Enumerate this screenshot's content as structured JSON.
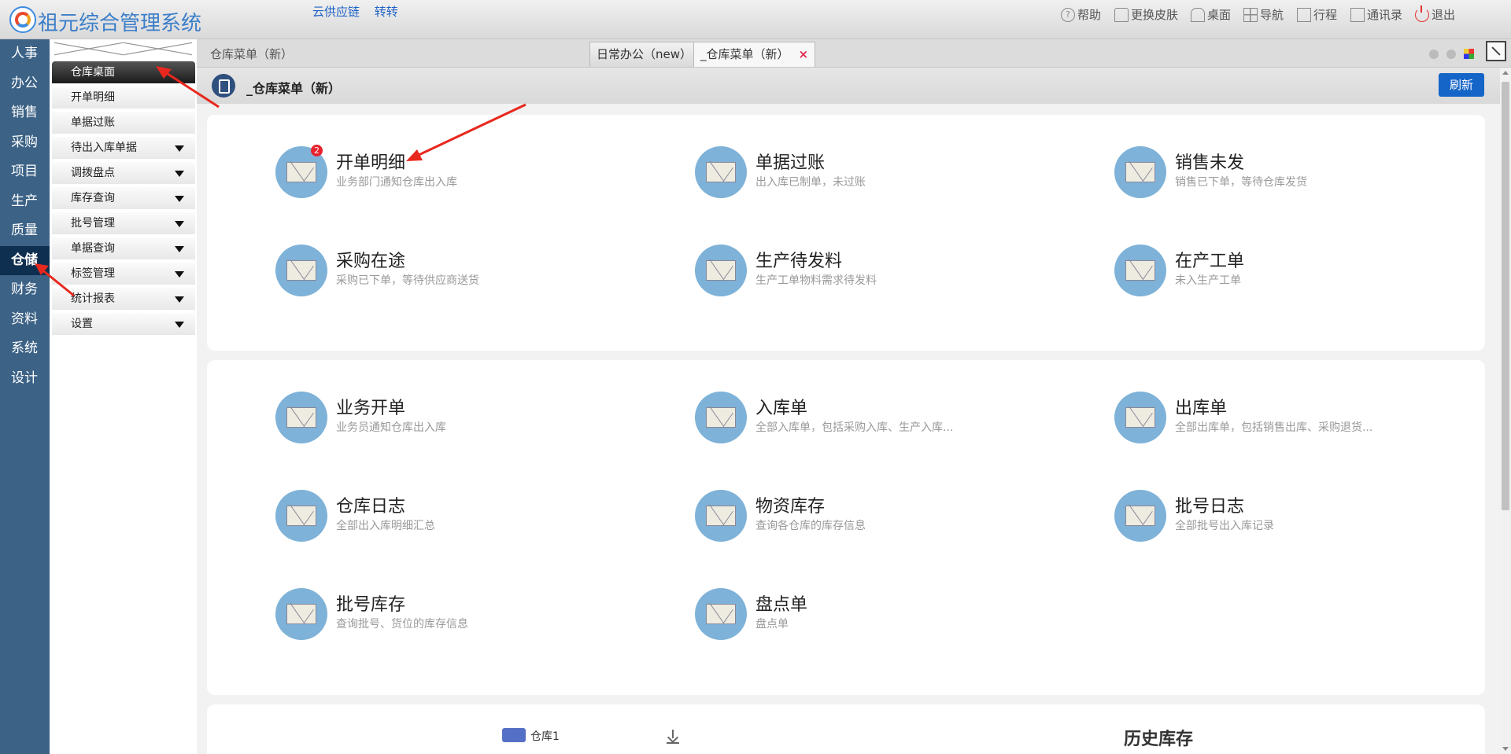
{
  "app": {
    "title": "祖元综合管理系统",
    "links": [
      "云供应链",
      "转转"
    ]
  },
  "toolbar": {
    "help": "帮助",
    "skin": "更换皮肤",
    "desktop": "桌面",
    "nav": "导航",
    "schedule": "行程",
    "contacts": "通讯录",
    "logout": "退出"
  },
  "left_nav": [
    "人事",
    "办公",
    "销售",
    "采购",
    "项目",
    "生产",
    "质量",
    "仓储",
    "财务",
    "资料",
    "系统",
    "设计"
  ],
  "left_nav_active": "仓储",
  "submenu": [
    {
      "label": "仓库桌面",
      "active": true,
      "dropdown": false
    },
    {
      "label": "开单明细",
      "dropdown": false
    },
    {
      "label": "单据过账",
      "dropdown": false
    },
    {
      "label": "待出入库单据",
      "dropdown": true
    },
    {
      "label": "调拨盘点",
      "dropdown": true
    },
    {
      "label": "库存查询",
      "dropdown": true
    },
    {
      "label": "批号管理",
      "dropdown": true
    },
    {
      "label": "单据查询",
      "dropdown": true
    },
    {
      "label": "标签管理",
      "dropdown": true
    },
    {
      "label": "统计报表",
      "dropdown": true
    },
    {
      "label": "设置",
      "dropdown": true
    }
  ],
  "breadcrumb": "仓库菜单（新）",
  "tabs": [
    {
      "label": "日常办公（new）",
      "active": false
    },
    {
      "label": "_仓库菜单（新）",
      "active": true,
      "close": "×"
    }
  ],
  "page": {
    "title": "_仓库菜单（新）",
    "refresh": "刷新"
  },
  "cards": [
    [
      {
        "title": "开单明细",
        "desc": "业务部门通知仓库出入库",
        "badge": "2"
      },
      {
        "title": "单据过账",
        "desc": "出入库已制单，未过账"
      },
      {
        "title": "销售未发",
        "desc": "销售已下单，等待仓库发货"
      },
      {
        "title": "采购在途",
        "desc": "采购已下单，等待供应商送货"
      },
      {
        "title": "生产待发料",
        "desc": "生产工单物料需求待发料"
      },
      {
        "title": "在产工单",
        "desc": "未入生产工单"
      }
    ],
    [
      {
        "title": "业务开单",
        "desc": "业务员通知仓库出入库"
      },
      {
        "title": "入库单",
        "desc": "全部入库单，包括采购入库、生产入库..."
      },
      {
        "title": "出库单",
        "desc": "全部出库单，包括销售出库、采购退货..."
      },
      {
        "title": "仓库日志",
        "desc": "全部出入库明细汇总"
      },
      {
        "title": "物资库存",
        "desc": "查询各仓库的库存信息"
      },
      {
        "title": "批号日志",
        "desc": "全部批号出入库记录"
      },
      {
        "title": "批号库存",
        "desc": "查询批号、货位的库存信息"
      },
      {
        "title": "盘点单",
        "desc": "盘点单"
      }
    ]
  ],
  "bottom": {
    "legend": "仓库1",
    "history_title": "历史库存"
  },
  "colors": {
    "nav_bg": "#3c6286",
    "nav_active": "#0f2f50",
    "accent": "#1565c8",
    "icon_circle": "#7eb2d8",
    "badge": "#e8212b",
    "annotation_arrow": "#e8281e"
  }
}
